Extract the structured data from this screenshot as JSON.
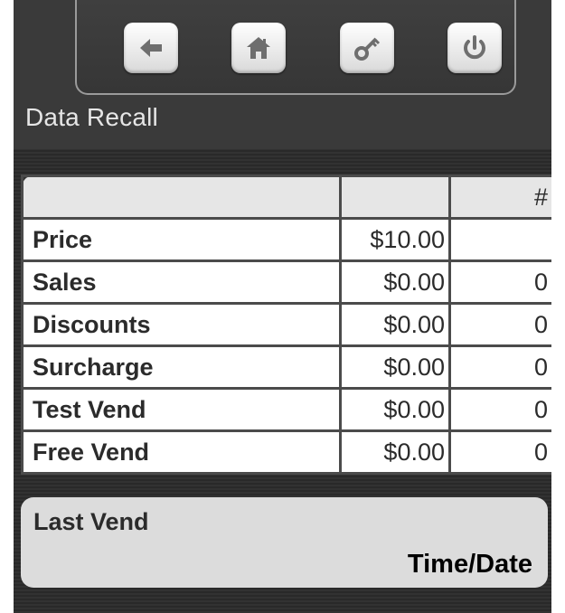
{
  "screen": {
    "title": "Data Recall"
  },
  "toolbar": {
    "buttons": [
      {
        "name": "back-button",
        "icon": "arrow-left-icon"
      },
      {
        "name": "home-button",
        "icon": "house-icon"
      },
      {
        "name": "key-button",
        "icon": "key-icon"
      },
      {
        "name": "power-button",
        "icon": "power-icon"
      }
    ]
  },
  "table": {
    "headers": [
      "",
      "",
      "#"
    ],
    "rows": [
      {
        "label": "Price",
        "amount": "$10.00",
        "count": ""
      },
      {
        "label": "Sales",
        "amount": "$0.00",
        "count": "0"
      },
      {
        "label": "Discounts",
        "amount": "$0.00",
        "count": "0"
      },
      {
        "label": "Surcharge",
        "amount": "$0.00",
        "count": "0"
      },
      {
        "label": "Test Vend",
        "amount": "$0.00",
        "count": "0"
      },
      {
        "label": "Free Vend",
        "amount": "$0.00",
        "count": "0"
      }
    ]
  },
  "last_vend": {
    "label": "Last Vend",
    "time_date": "Time/Date"
  },
  "colors": {
    "background": "#2b2b2b",
    "icon": "#6e6e6e",
    "table_border": "#4b4b4b"
  }
}
